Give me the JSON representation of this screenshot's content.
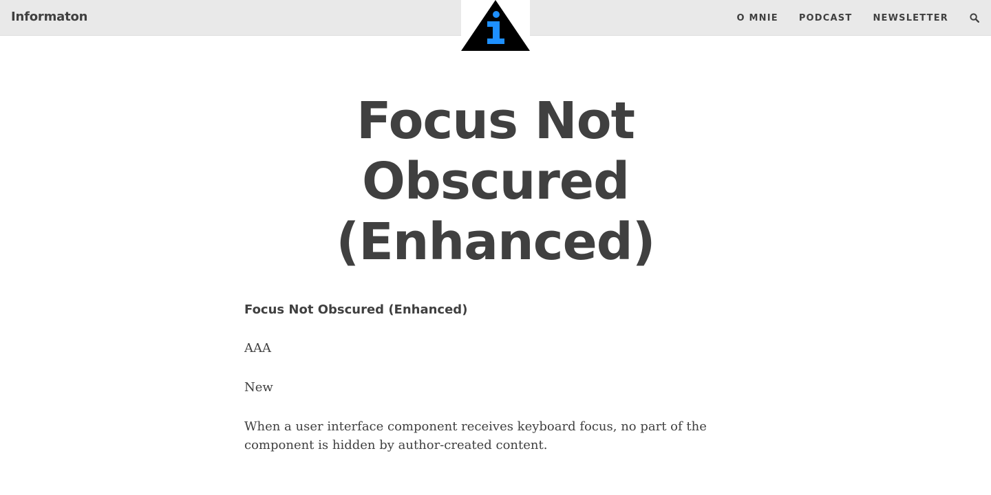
{
  "header": {
    "brand": "Informaton",
    "logo_icon": "info-triangle-icon",
    "nav": [
      {
        "label": "O MNIE"
      },
      {
        "label": "PODCAST"
      },
      {
        "label": "NEWSLETTER"
      }
    ],
    "search_icon": "search-icon"
  },
  "article": {
    "title": "Focus Not Obscured (Enhanced)",
    "heading": "Focus Not Obscured (Enhanced)",
    "level": "AAA",
    "status": "New",
    "description": "When a user interface component receives keyboard focus, no part of the component is hidden by author-created content."
  },
  "colors": {
    "header_bg": "#e9e9e9",
    "text": "#404040",
    "logo_triangle": "#000000",
    "logo_info": "#1e90ff"
  }
}
